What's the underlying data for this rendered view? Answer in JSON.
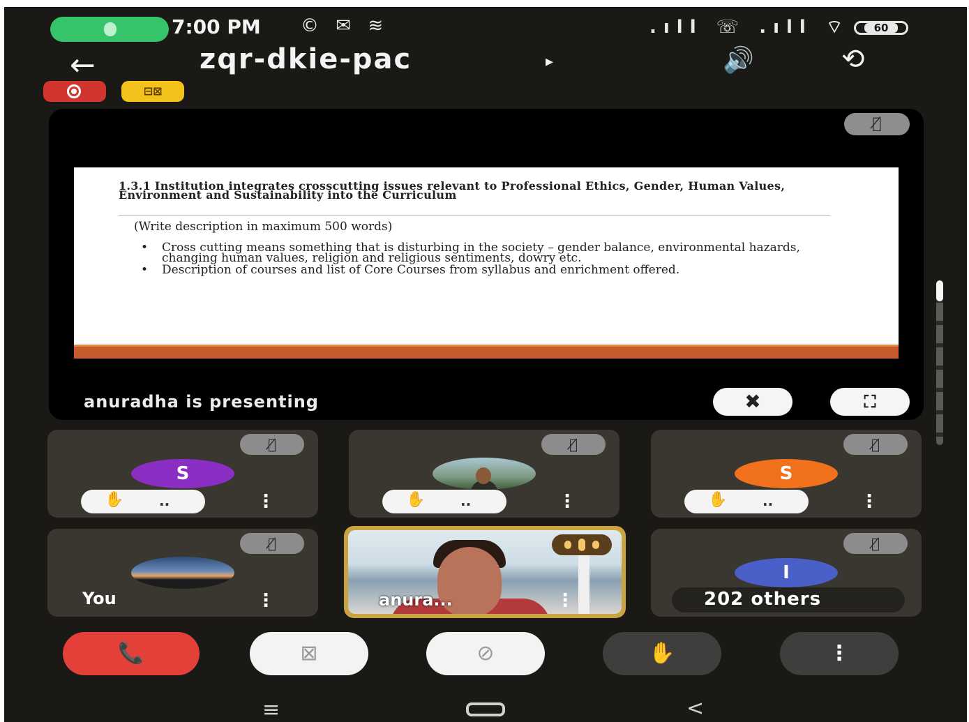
{
  "status_bar": {
    "time": "7:00 PM",
    "left_icons": "© ✉ ≋",
    "right_icons": ".ıll ☏ .ıll ⌔",
    "battery": "60"
  },
  "header": {
    "back_icon": "←",
    "title": "zqr-dkie-pac",
    "title_caret": "▸",
    "speaker_icon": "🔊",
    "rotate_icon": "⟲"
  },
  "badges": {
    "recording": "recording-icon",
    "captions_icon": "cc-off-icon",
    "captions_text": "⊟⊠"
  },
  "presentation": {
    "slide": {
      "heading": "1.3.1 Institution integrates crosscutting issues relevant to Professional Ethics, Gender, Human Values, Environment and Sustainability into the Curriculum",
      "sub": "(Write description in maximum 500 words)",
      "bullets": [
        "Cross cutting means something that is disturbing in the society – gender balance, environmental hazards, changing human values, religion and religious sentiments, dowry etc.",
        "Description of courses and list of Core Courses from syllabus and enrichment offered."
      ]
    },
    "presenting_text": "anuradha is presenting",
    "pin_icon": "✖",
    "fullscreen_icon": "⛶"
  },
  "participants": [
    {
      "type": "initial",
      "initial": "S",
      "color": "#8b2fc4"
    },
    {
      "type": "photo"
    },
    {
      "type": "initial",
      "initial": "S",
      "color": "#f2711c"
    },
    {
      "type": "self",
      "name": "You"
    },
    {
      "type": "video",
      "name": "anura..."
    },
    {
      "type": "others",
      "initial": "I",
      "color": "#4b5fc8",
      "text": "202 others"
    }
  ],
  "icons": {
    "muted": "mic-off-icon",
    "muted_glyph": "🎙̸",
    "hand": "✋",
    "more": "⋮",
    "dots": ".."
  },
  "controls": {
    "end_call": "📞",
    "camera": "camera-off-icon",
    "camera_glyph": "⊠",
    "mic": "mic-off-icon",
    "mic_glyph": "⊘",
    "raise_hand": "✋",
    "more": "⋮"
  },
  "nav": {
    "menu": "≡",
    "back": "<"
  }
}
